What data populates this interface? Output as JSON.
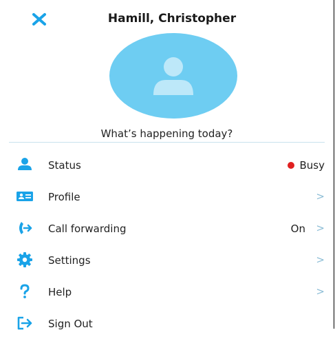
{
  "title": "Hamill, Christopher",
  "mood_prompt": "What’s happening today?",
  "menu": {
    "status": {
      "label": "Status",
      "value": "Busy",
      "icon": "person-icon"
    },
    "profile": {
      "label": "Profile",
      "icon": "id-card-icon"
    },
    "call_forwarding": {
      "label": "Call forwarding",
      "value": "On",
      "icon": "call-forward-icon"
    },
    "settings": {
      "label": "Settings",
      "icon": "gear-icon"
    },
    "help": {
      "label": "Help",
      "icon": "question-icon"
    },
    "sign_out": {
      "label": "Sign Out",
      "icon": "sign-out-icon"
    }
  },
  "colors": {
    "accent": "#1aa3e8",
    "avatar_bg": "#6ecdf2",
    "busy_dot": "#e02020",
    "chevron": "#8cbdd6"
  }
}
